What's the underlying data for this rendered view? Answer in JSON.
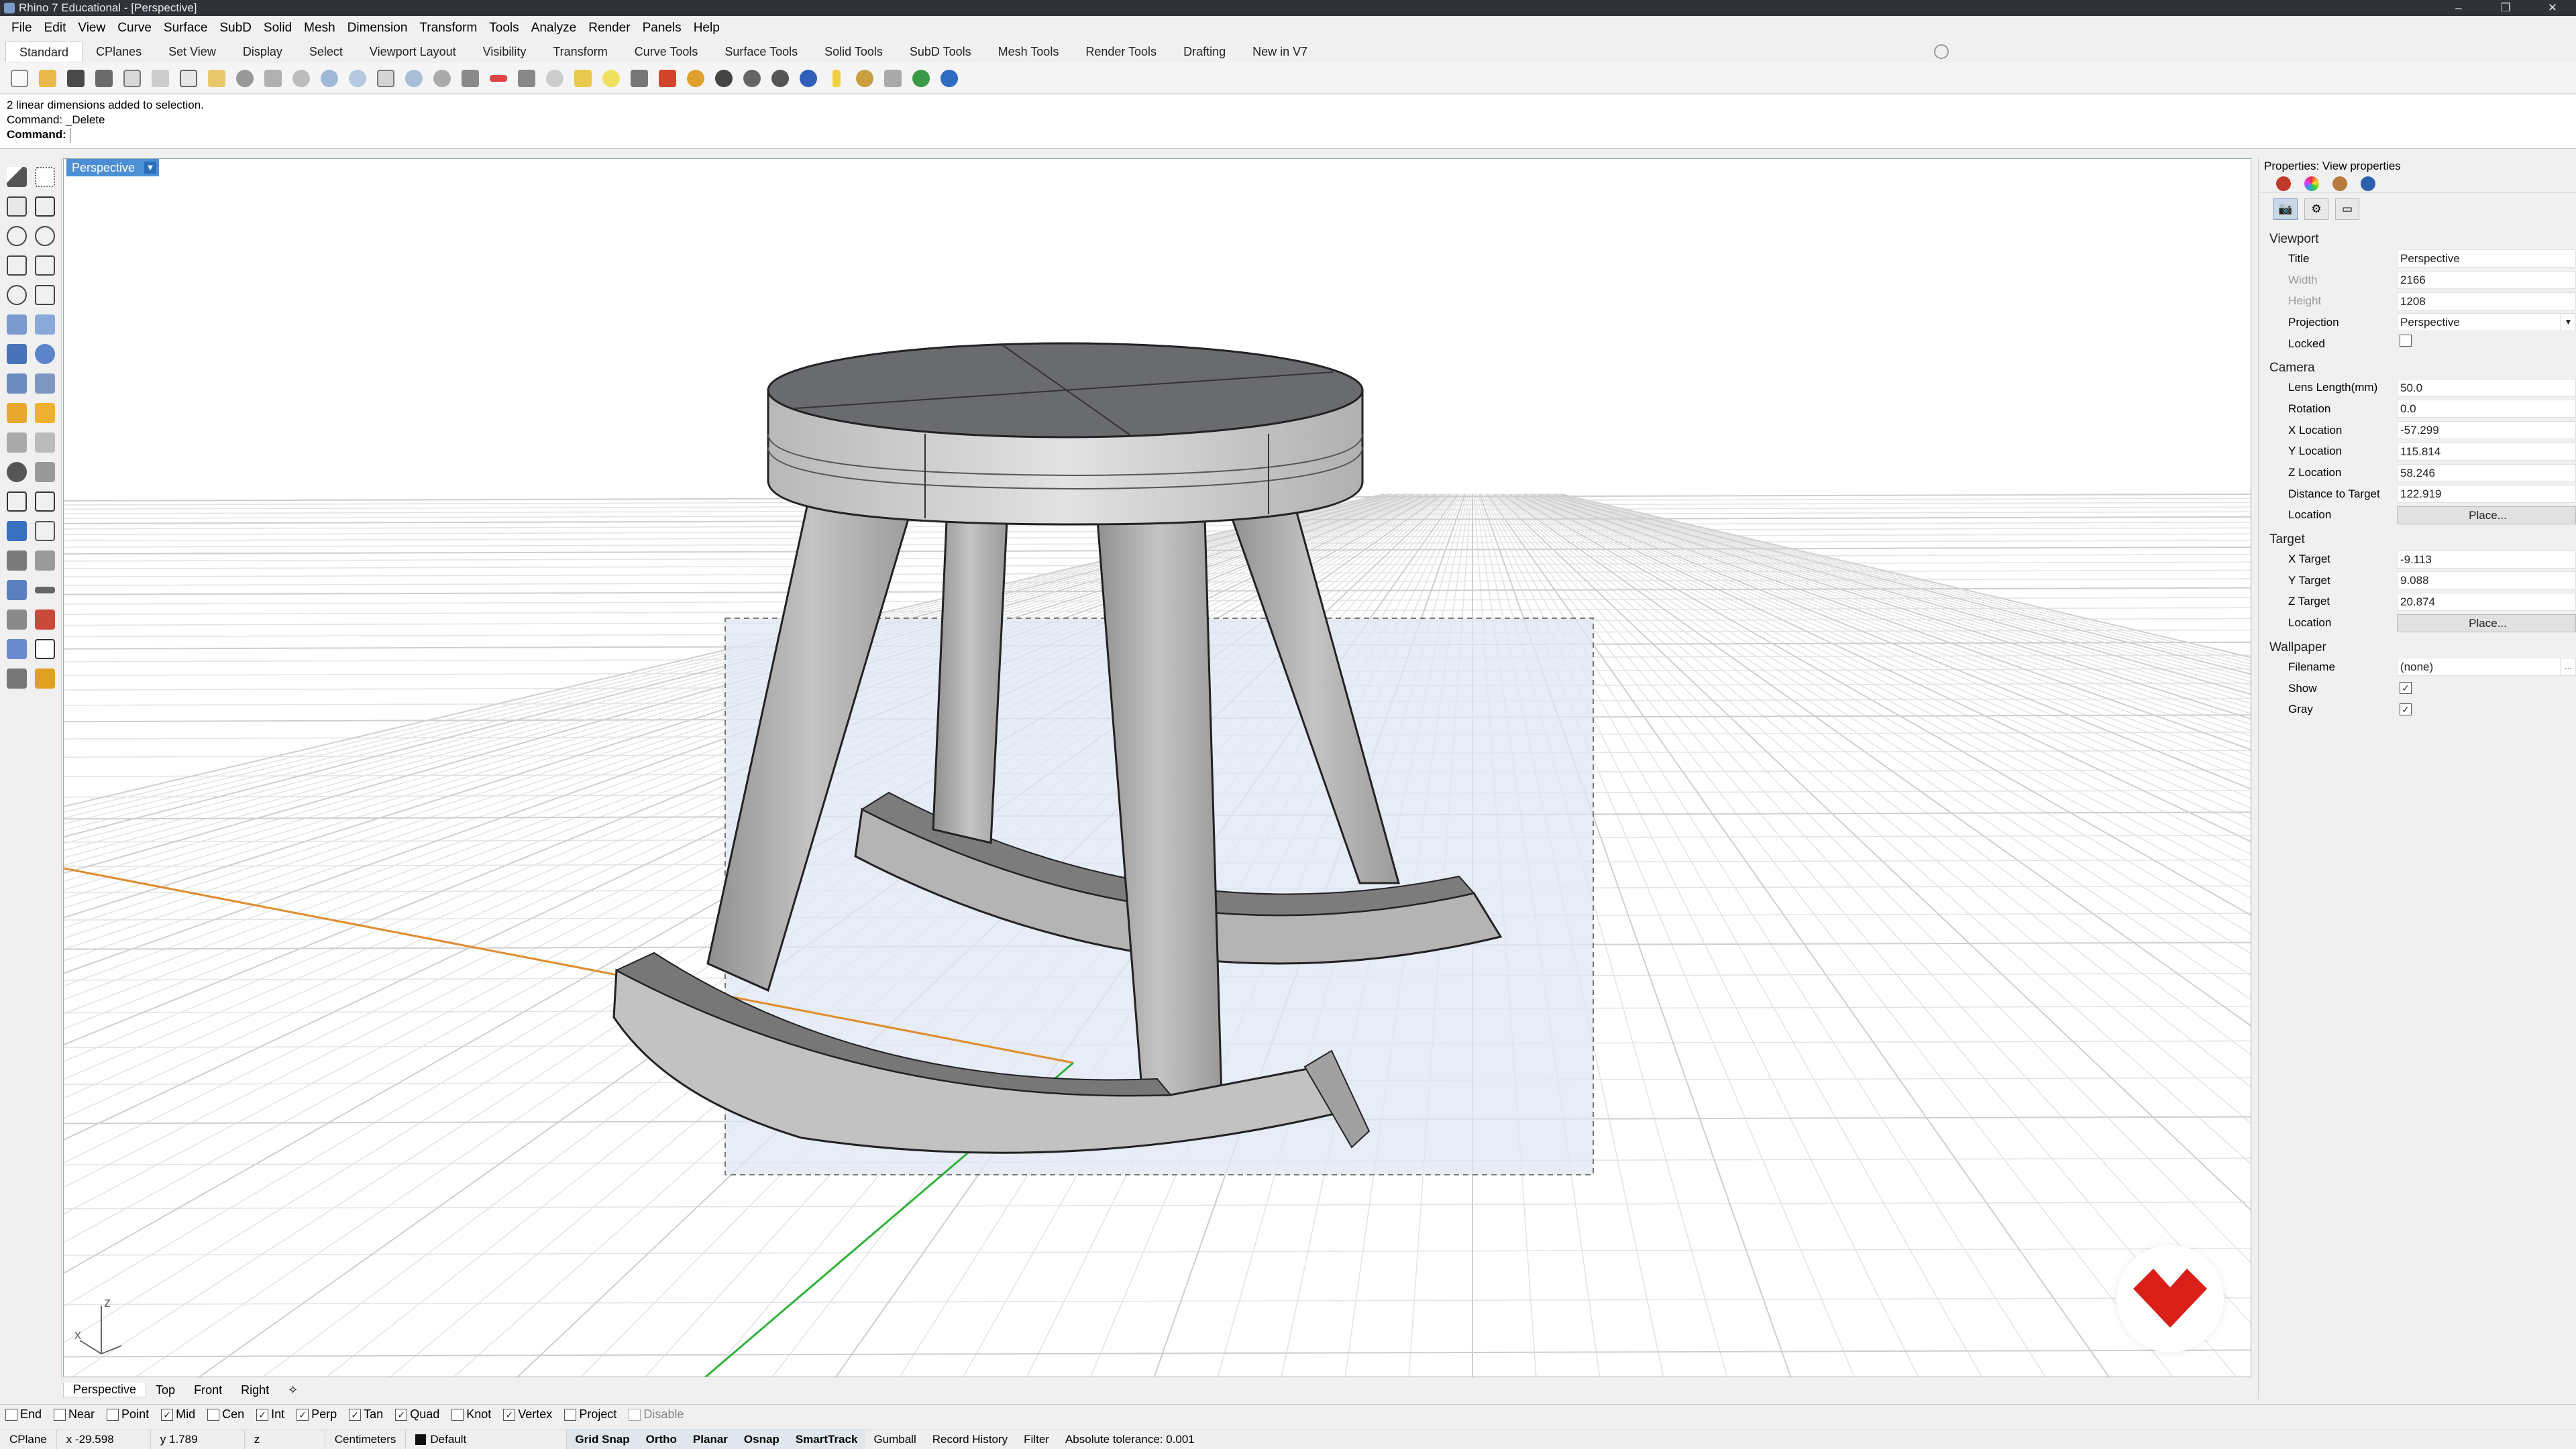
{
  "window": {
    "title": "Rhino 7 Educational - [Perspective]"
  },
  "menu": [
    "File",
    "Edit",
    "View",
    "Curve",
    "Surface",
    "SubD",
    "Solid",
    "Mesh",
    "Dimension",
    "Transform",
    "Tools",
    "Analyze",
    "Render",
    "Panels",
    "Help"
  ],
  "tabs": [
    "Standard",
    "CPlanes",
    "Set View",
    "Display",
    "Select",
    "Viewport Layout",
    "Visibility",
    "Transform",
    "Curve Tools",
    "Surface Tools",
    "Solid Tools",
    "SubD Tools",
    "Mesh Tools",
    "Render Tools",
    "Drafting",
    "New in V7"
  ],
  "command": {
    "history": [
      "2 linear dimensions added to selection.",
      "Command: _Delete"
    ],
    "prompt": "Command:"
  },
  "viewport": {
    "active_label": "Perspective",
    "axis_x": "x",
    "axis_z": "z",
    "colors": {
      "x_axis": "#e08c2e",
      "y_axis": "#2fb23a",
      "selection": "#dfe6f4"
    }
  },
  "viewport_tabs": [
    "Perspective",
    "Top",
    "Front",
    "Right"
  ],
  "osnaps": [
    {
      "label": "End",
      "checked": false
    },
    {
      "label": "Near",
      "checked": false
    },
    {
      "label": "Point",
      "checked": false
    },
    {
      "label": "Mid",
      "checked": true
    },
    {
      "label": "Cen",
      "checked": false
    },
    {
      "label": "Int",
      "checked": true
    },
    {
      "label": "Perp",
      "checked": true
    },
    {
      "label": "Tan",
      "checked": true
    },
    {
      "label": "Quad",
      "checked": true
    },
    {
      "label": "Knot",
      "checked": false
    },
    {
      "label": "Vertex",
      "checked": true
    },
    {
      "label": "Project",
      "checked": false
    },
    {
      "label": "Disable",
      "checked": false
    }
  ],
  "status": {
    "cplane": "CPlane",
    "x": "x -29.598",
    "y": "y 1.789",
    "z": "z",
    "units": "Centimeters",
    "layer": "Default",
    "toggles": [
      "Grid Snap",
      "Ortho",
      "Planar",
      "Osnap",
      "SmartTrack",
      "Gumball",
      "Record History",
      "Filter"
    ],
    "toggles_on": [
      true,
      true,
      true,
      true,
      true,
      false,
      false,
      false
    ],
    "tolerance": "Absolute tolerance: 0.001"
  },
  "properties": {
    "header": "Properties: View properties",
    "viewport_section": "Viewport",
    "viewport_rows": [
      {
        "label": "Title",
        "value": "Perspective"
      },
      {
        "label": "Width",
        "value": "2166"
      },
      {
        "label": "Height",
        "value": "1208"
      },
      {
        "label": "Projection",
        "value": "Perspective"
      },
      {
        "label": "Locked",
        "value": ""
      }
    ],
    "camera_section": "Camera",
    "camera_rows": [
      {
        "label": "Lens Length(mm)",
        "value": "50.0"
      },
      {
        "label": "Rotation",
        "value": "0.0"
      },
      {
        "label": "X Location",
        "value": "-57.299"
      },
      {
        "label": "Y Location",
        "value": "115.814"
      },
      {
        "label": "Z Location",
        "value": "58.246"
      },
      {
        "label": "Distance to Target",
        "value": "122.919"
      },
      {
        "label": "Location",
        "value": "Place..."
      }
    ],
    "target_section": "Target",
    "target_rows": [
      {
        "label": "X Target",
        "value": "-9.113"
      },
      {
        "label": "Y Target",
        "value": "9.088"
      },
      {
        "label": "Z Target",
        "value": "20.874"
      },
      {
        "label": "Location",
        "value": "Place..."
      }
    ],
    "wallpaper_section": "Wallpaper",
    "wallpaper_rows": [
      {
        "label": "Filename",
        "value": "(none)"
      },
      {
        "label": "Show",
        "value": ""
      },
      {
        "label": "Gray",
        "value": ""
      }
    ]
  }
}
